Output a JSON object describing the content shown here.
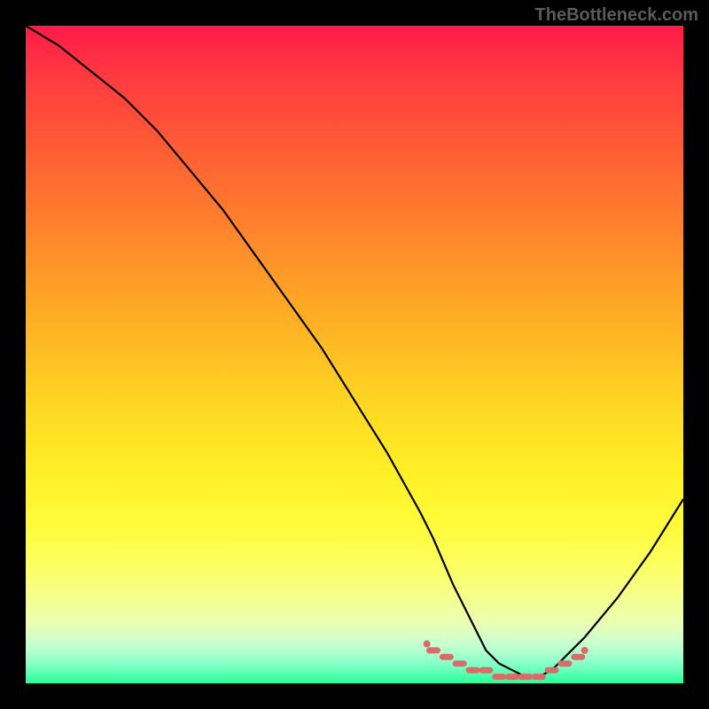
{
  "watermark": "TheBottleneck.com",
  "chart_data": {
    "type": "line",
    "title": "",
    "xlabel": "",
    "ylabel": "",
    "xlim": [
      0,
      100
    ],
    "ylim": [
      0,
      100
    ],
    "series": [
      {
        "name": "bottleneck-curve",
        "x": [
          0,
          5,
          10,
          15,
          20,
          25,
          30,
          35,
          40,
          45,
          50,
          55,
          60,
          62,
          65,
          68,
          70,
          72,
          74,
          76,
          78,
          80,
          82,
          85,
          90,
          95,
          100
        ],
        "y": [
          100,
          97,
          93,
          89,
          84,
          78,
          72,
          65,
          58,
          51,
          43,
          35,
          26,
          22,
          15,
          9,
          5,
          3,
          2,
          1,
          1,
          2,
          4,
          7,
          13,
          20,
          28
        ]
      }
    ],
    "markers": {
      "name": "optimal-band",
      "x": [
        62,
        64,
        66,
        68,
        70,
        72,
        74,
        76,
        78,
        80,
        82,
        84
      ],
      "y": [
        5,
        4,
        3,
        2,
        2,
        1,
        1,
        1,
        1,
        2,
        3,
        4
      ]
    },
    "colors": {
      "curve": "#000000",
      "marker": "#d96b6b",
      "top": "#ff1a4a",
      "mid": "#ffe228",
      "bottom": "#2aff9a"
    }
  }
}
